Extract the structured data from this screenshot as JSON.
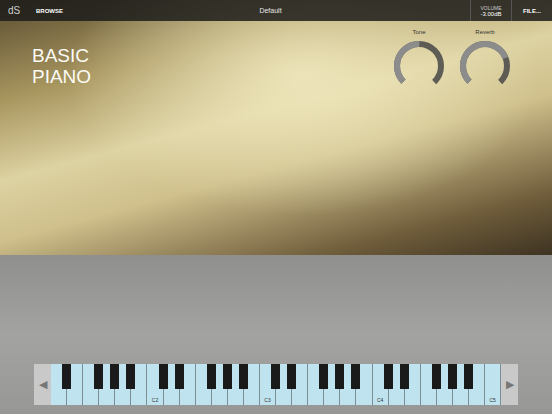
{
  "top_bar": {
    "logo": "dS",
    "browse": "BROWSE",
    "preset": "Default",
    "volume_label": "VOLUME",
    "volume_value": "-3.00dB",
    "file": "FILE..."
  },
  "title_lines": [
    "BASIC",
    "PIANO"
  ],
  "knobs": [
    {
      "label": "Tone",
      "level": 0.5
    },
    {
      "label": "Reverb",
      "level": 0.75
    }
  ],
  "keyboard": {
    "left_arrow": "◀",
    "right_arrow": "▶",
    "keys": [
      {
        "label": "",
        "has_black": true
      },
      {
        "label": "",
        "has_black": false
      },
      {
        "label": "",
        "has_black": true
      },
      {
        "label": "",
        "has_black": true
      },
      {
        "label": "",
        "has_black": true
      },
      {
        "label": "",
        "has_black": false
      },
      {
        "label": "C2",
        "has_black": true
      },
      {
        "label": "",
        "has_black": true
      },
      {
        "label": "",
        "has_black": false
      },
      {
        "label": "",
        "has_black": true
      },
      {
        "label": "",
        "has_black": true
      },
      {
        "label": "",
        "has_black": true
      },
      {
        "label": "",
        "has_black": false
      },
      {
        "label": "C3",
        "has_black": true
      },
      {
        "label": "",
        "has_black": true
      },
      {
        "label": "",
        "has_black": false
      },
      {
        "label": "",
        "has_black": true
      },
      {
        "label": "",
        "has_black": true
      },
      {
        "label": "",
        "has_black": true
      },
      {
        "label": "",
        "has_black": false
      },
      {
        "label": "C4",
        "has_black": true
      },
      {
        "label": "",
        "has_black": true
      },
      {
        "label": "",
        "has_black": false
      },
      {
        "label": "",
        "has_black": true
      },
      {
        "label": "",
        "has_black": true
      },
      {
        "label": "",
        "has_black": true
      },
      {
        "label": "",
        "has_black": false
      },
      {
        "label": "C5",
        "has_black": false
      }
    ]
  }
}
